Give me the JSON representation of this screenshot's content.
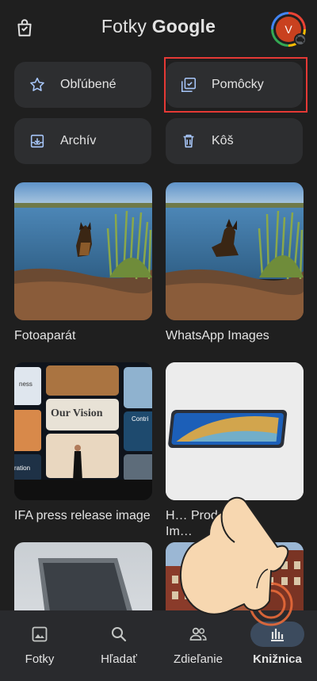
{
  "app": {
    "title_prefix": "Fotky",
    "title_brand": "Google",
    "avatar_initial": "V"
  },
  "shortcuts": [
    {
      "label": "Obľúbené",
      "icon": "star-icon"
    },
    {
      "label": "Pomôcky",
      "icon": "utilities-icon"
    },
    {
      "label": "Archív",
      "icon": "archive-icon"
    },
    {
      "label": "Kôš",
      "icon": "trash-icon"
    }
  ],
  "albums": [
    {
      "title": "Fotoaparát"
    },
    {
      "title": "WhatsApp Images"
    },
    {
      "title": "IFA press release image",
      "overlay_texts": [
        "ness",
        "Our Vision",
        "Contri",
        "ration"
      ]
    },
    {
      "title": "H… Product",
      "title_line2": "Im…"
    },
    {
      "title": ""
    },
    {
      "title": ""
    }
  ],
  "bottom_nav": [
    {
      "label": "Fotky",
      "icon": "photo-icon"
    },
    {
      "label": "Hľadať",
      "icon": "search-icon"
    },
    {
      "label": "Zdieľanie",
      "icon": "people-icon"
    },
    {
      "label": "Knižnica",
      "icon": "library-icon",
      "active": true
    }
  ],
  "colors": {
    "background": "#1f1f1f",
    "chip": "#2d2e30",
    "highlight": "#e53935",
    "active_nav": "#3c4b5e"
  }
}
